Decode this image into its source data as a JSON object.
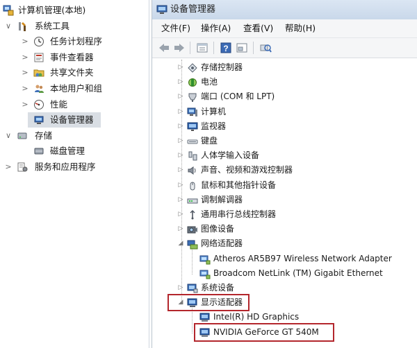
{
  "left_tree": {
    "items": [
      {
        "label": "计算机管理(本地)",
        "expander": "",
        "icon": "computer-management-icon"
      },
      {
        "label": "系统工具",
        "expander": "∨",
        "icon": "system-tools-icon"
      },
      {
        "label": "任务计划程序",
        "expander": ">",
        "icon": "clock-icon"
      },
      {
        "label": "事件查看器",
        "expander": ">",
        "icon": "event-viewer-icon"
      },
      {
        "label": "共享文件夹",
        "expander": ">",
        "icon": "shared-folder-icon"
      },
      {
        "label": "本地用户和组",
        "expander": ">",
        "icon": "users-icon"
      },
      {
        "label": "性能",
        "expander": ">",
        "icon": "performance-icon"
      },
      {
        "label": "设备管理器",
        "expander": "",
        "icon": "device-manager-icon",
        "selected": true
      },
      {
        "label": "存储",
        "expander": "∨",
        "icon": "storage-icon"
      },
      {
        "label": "磁盘管理",
        "expander": "",
        "icon": "disk-icon"
      },
      {
        "label": "服务和应用程序",
        "expander": ">",
        "icon": "services-icon"
      }
    ]
  },
  "window": {
    "title": "设备管理器",
    "menu": [
      "文件(F)",
      "操作(A)",
      "查看(V)",
      "帮助(H)"
    ],
    "toolbar_icons": [
      "back-arrow-icon",
      "forward-arrow-icon",
      "properties-icon",
      "help-icon",
      "view-icon",
      "scan-hardware-icon"
    ]
  },
  "device_tree": {
    "items": [
      {
        "label": "存储控制器",
        "icon": "storage-controller-icon",
        "expander": "▷"
      },
      {
        "label": "电池",
        "icon": "battery-icon",
        "expander": "▷"
      },
      {
        "label": "端口 (COM 和 LPT)",
        "icon": "port-icon",
        "expander": "▷"
      },
      {
        "label": "计算机",
        "icon": "computer-icon",
        "expander": "▷"
      },
      {
        "label": "监视器",
        "icon": "monitor-icon",
        "expander": "▷"
      },
      {
        "label": "键盘",
        "icon": "keyboard-icon",
        "expander": "▷"
      },
      {
        "label": "人体学输入设备",
        "icon": "hid-icon",
        "expander": "▷"
      },
      {
        "label": "声音、视频和游戏控制器",
        "icon": "speaker-icon",
        "expander": "▷"
      },
      {
        "label": "鼠标和其他指针设备",
        "icon": "mouse-icon",
        "expander": "▷"
      },
      {
        "label": "调制解调器",
        "icon": "modem-icon",
        "expander": "▷"
      },
      {
        "label": "通用串行总线控制器",
        "icon": "usb-icon",
        "expander": "▷"
      },
      {
        "label": "图像设备",
        "icon": "camera-icon",
        "expander": "▷"
      },
      {
        "label": "网络适配器",
        "icon": "network-adapter-icon",
        "expander": "◢"
      },
      {
        "label": "Atheros AR5B97 Wireless Network Adapter",
        "icon": "network-card-icon",
        "expander": ""
      },
      {
        "label": "Broadcom NetLink (TM) Gigabit Ethernet",
        "icon": "network-card-icon",
        "expander": ""
      },
      {
        "label": "系统设备",
        "icon": "system-device-icon",
        "expander": "▷"
      },
      {
        "label": "显示适配器",
        "icon": "display-adapter-icon",
        "expander": "◢"
      },
      {
        "label": "Intel(R) HD Graphics",
        "icon": "display-card-icon",
        "expander": ""
      },
      {
        "label": "NVIDIA GeForce GT 540M",
        "icon": "display-card-icon",
        "expander": ""
      }
    ]
  },
  "colors": {
    "highlight_border": "#b3262c",
    "selection_bg": "#d9dee4"
  }
}
